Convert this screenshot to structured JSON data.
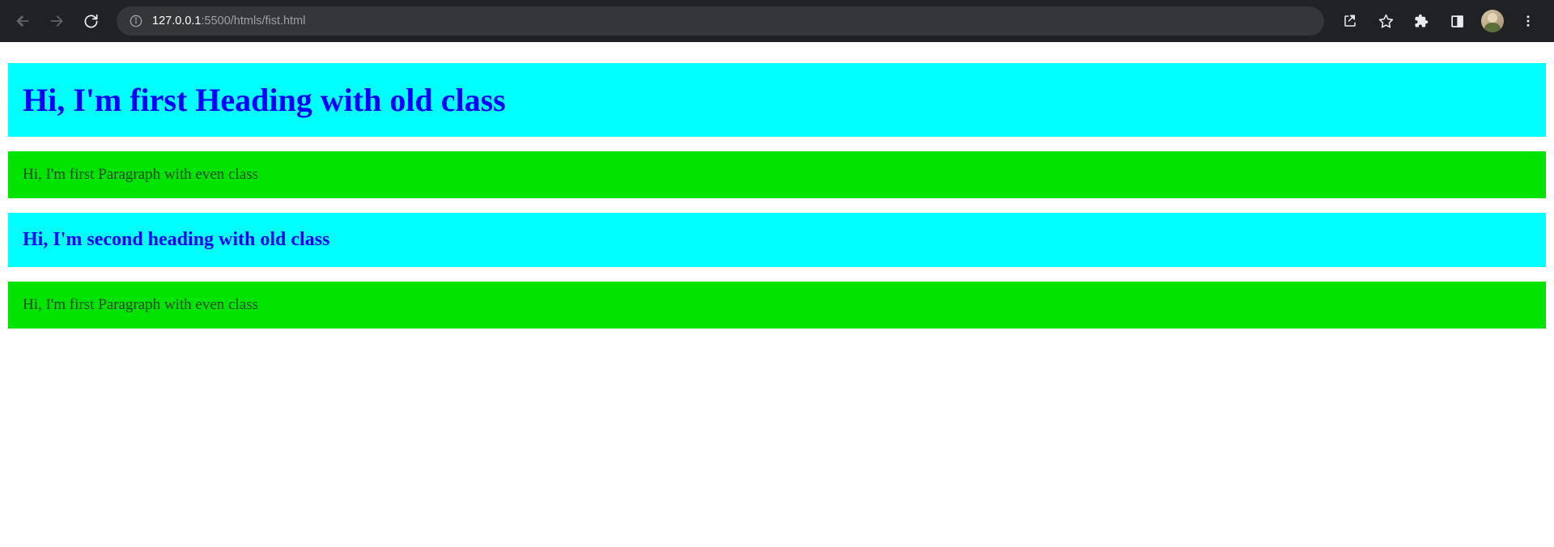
{
  "browser": {
    "url_host": "127.0.0.1",
    "url_port": ":5500",
    "url_path": "/htmls/fist.html"
  },
  "content": {
    "heading1": "Hi, I'm first Heading with old class",
    "paragraph1": "Hi, I'm first Paragraph with even class",
    "heading2": "Hi, I'm second heading with old class",
    "paragraph2": "Hi, I'm first Paragraph with even class"
  }
}
